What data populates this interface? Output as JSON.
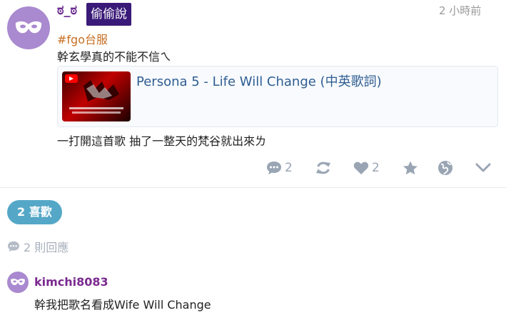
{
  "post": {
    "username": "ಠ_ಠ",
    "tag_badge": "偷偷說",
    "timestamp": "2 小時前",
    "board_tag": "#fgo台服",
    "text_line1": "幹玄學真的不能不信ㄟ",
    "link_card": {
      "title": "Persona 5 - Life Will Change (中英歌詞)"
    },
    "text_line2": "一打開這首歌 抽了一整天的梵谷就出來ㄌ",
    "actions": {
      "comment_count": "2",
      "like_count": "2"
    }
  },
  "likes_button": "2 喜歡",
  "replies": {
    "count_label": "2 則回應"
  },
  "comment": {
    "username": "kimchi8083",
    "text": "幹我把歌名看成Wife Will Change"
  },
  "colors": {
    "accent": "#55a7c7",
    "username": "#6b2a90",
    "board_tag": "#c86f22",
    "avatar": "#a989cf"
  }
}
